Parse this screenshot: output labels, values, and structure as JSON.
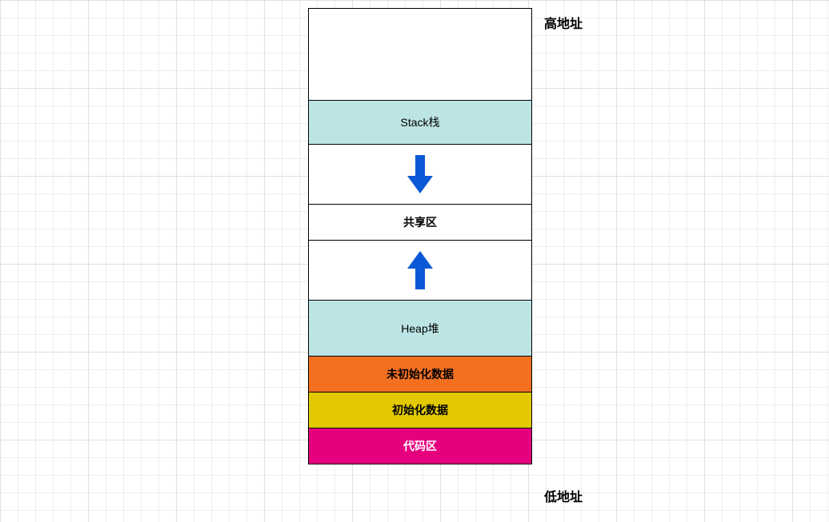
{
  "diagram": {
    "high_label": "高地址",
    "low_label": "低地址",
    "segments": {
      "blank_top": "",
      "stack": "Stack栈",
      "shared": "共享区",
      "heap": "Heap堆",
      "bss": "未初始化数据",
      "data": "初始化数据",
      "text": "代码区"
    },
    "arrow_color": "#0b59d6",
    "colors": {
      "teal": "#bde4e4",
      "orange": "#f37021",
      "yellow": "#e2c900",
      "magenta": "#e6007e"
    }
  }
}
